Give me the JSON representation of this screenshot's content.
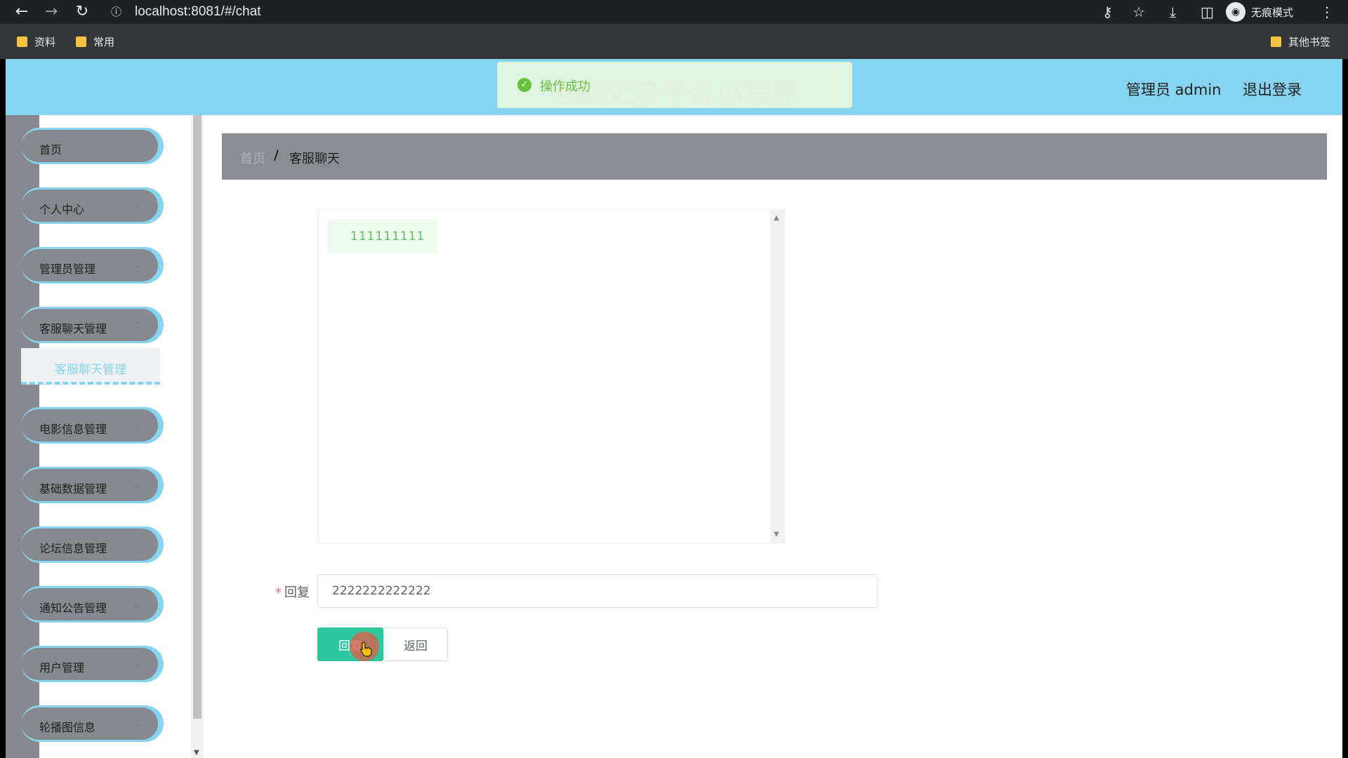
{
  "browser": {
    "url": "localhost:8081/#/chat",
    "incognito_label": "无痕模式",
    "bookmarks": [
      "资料",
      "常用"
    ],
    "other_bookmarks": "其他书签"
  },
  "header": {
    "title": "电影交流平台小程序",
    "user": "管理员 admin",
    "logout": "退出登录"
  },
  "toast": {
    "message": "操作成功"
  },
  "sidebar": {
    "items": [
      {
        "label": "首页"
      },
      {
        "label": "个人中心"
      },
      {
        "label": "管理员管理"
      },
      {
        "label": "客服聊天管理"
      },
      {
        "label": "电影信息管理"
      },
      {
        "label": "基础数据管理"
      },
      {
        "label": "论坛信息管理"
      },
      {
        "label": "通知公告管理"
      },
      {
        "label": "用户管理"
      },
      {
        "label": "轮播图信息"
      }
    ],
    "active_sub": "客服聊天管理"
  },
  "breadcrumb": {
    "home": "首页",
    "current": "客服聊天"
  },
  "chat": {
    "messages": [
      "111111111"
    ]
  },
  "form": {
    "reply_label": "回复",
    "reply_value": "2222222222222",
    "submit_label": "回复",
    "back_label": "返回"
  },
  "colors": {
    "accent": "#86d4ef",
    "primary_button": "#2ec7a0",
    "sidebar_gray": "#87898e"
  }
}
